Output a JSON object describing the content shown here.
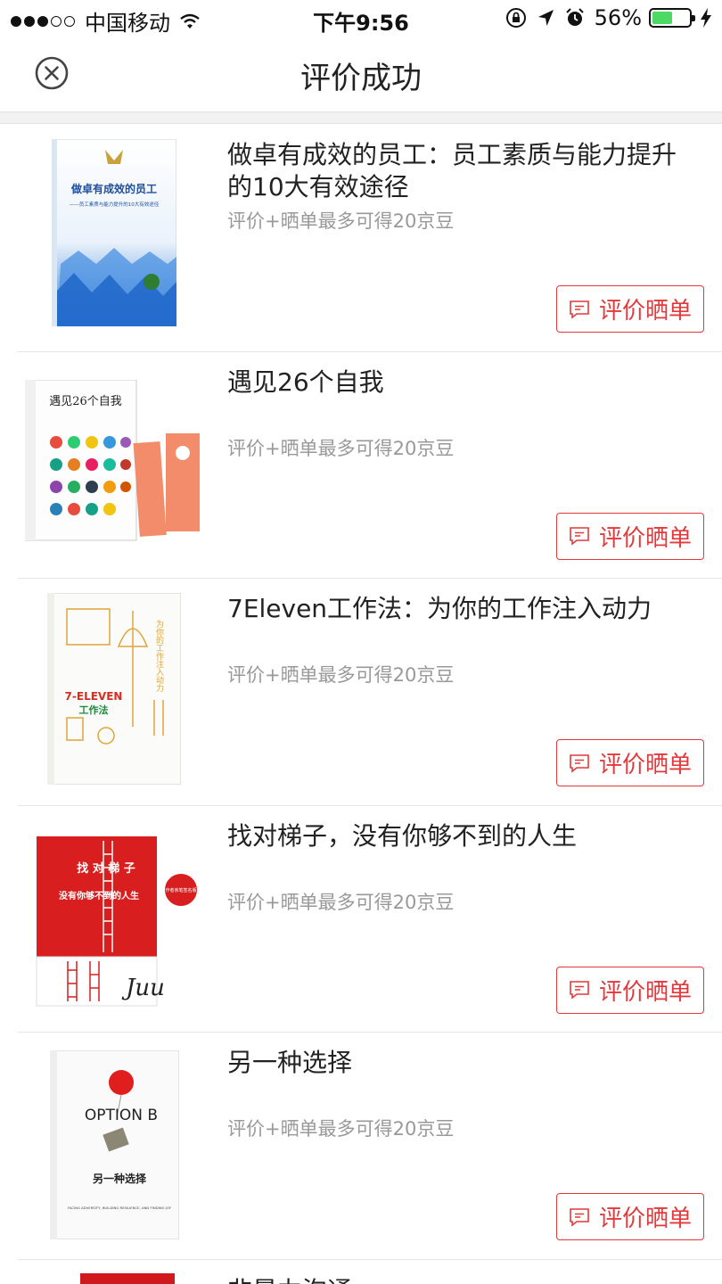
{
  "status_bar": {
    "carrier": "中国移动",
    "time": "下午9:56",
    "battery": "56%",
    "battery_level": 0.56,
    "icons": [
      "signal-dots-icon",
      "wifi-icon",
      "rotation-lock-icon",
      "location-arrow-icon",
      "alarm-icon",
      "battery-icon",
      "charging-bolt-icon"
    ]
  },
  "nav": {
    "title": "评价成功",
    "close_icon": "close-circle-icon"
  },
  "items": [
    {
      "title": "做卓有成效的员工：员工素质与能力提升的10大有效途径",
      "hint": "评价+晒单最多可得20京豆",
      "button": "评价晒单",
      "cover": {
        "title": "做卓有成效的员工",
        "subtitle": "——员工素质与能力提升的10大有效途径"
      }
    },
    {
      "title": "遇见26个自我",
      "hint": "评价+晒单最多可得20京豆",
      "button": "评价晒单",
      "cover": {
        "title": "遇见26个自我"
      }
    },
    {
      "title": "7Eleven工作法：为你的工作注入动力",
      "hint": "评价+晒单最多可得20京豆",
      "button": "评价晒单",
      "cover": {
        "title": "7-ELEVEN",
        "subtitle": "工作法",
        "tagline": "为你的工作注入动力"
      }
    },
    {
      "title": "找对梯子，没有你够不到的人生",
      "hint": "评价+晒单最多可得20京豆",
      "button": "评价晒单",
      "cover": {
        "title": "找 对 梯 子",
        "subtitle": "没有你够不到的人生",
        "badge": "作者亲笔签名版",
        "signature": "Juu"
      }
    },
    {
      "title": "另一种选择",
      "hint": "评价+晒单最多可得20京豆",
      "button": "评价晒单",
      "cover": {
        "title": "OPTION B",
        "subtitle": "另一种选择",
        "tagline": "FACING ADVERSITY, BUILDING RESILIENCE, AND FINDING JOY"
      }
    }
  ],
  "partial_item": {
    "title": "非暴力沟通"
  },
  "colors": {
    "accent": "#e4393c",
    "hint": "#999999",
    "divider": "#e5e5e5",
    "battery": "#4cd964"
  }
}
